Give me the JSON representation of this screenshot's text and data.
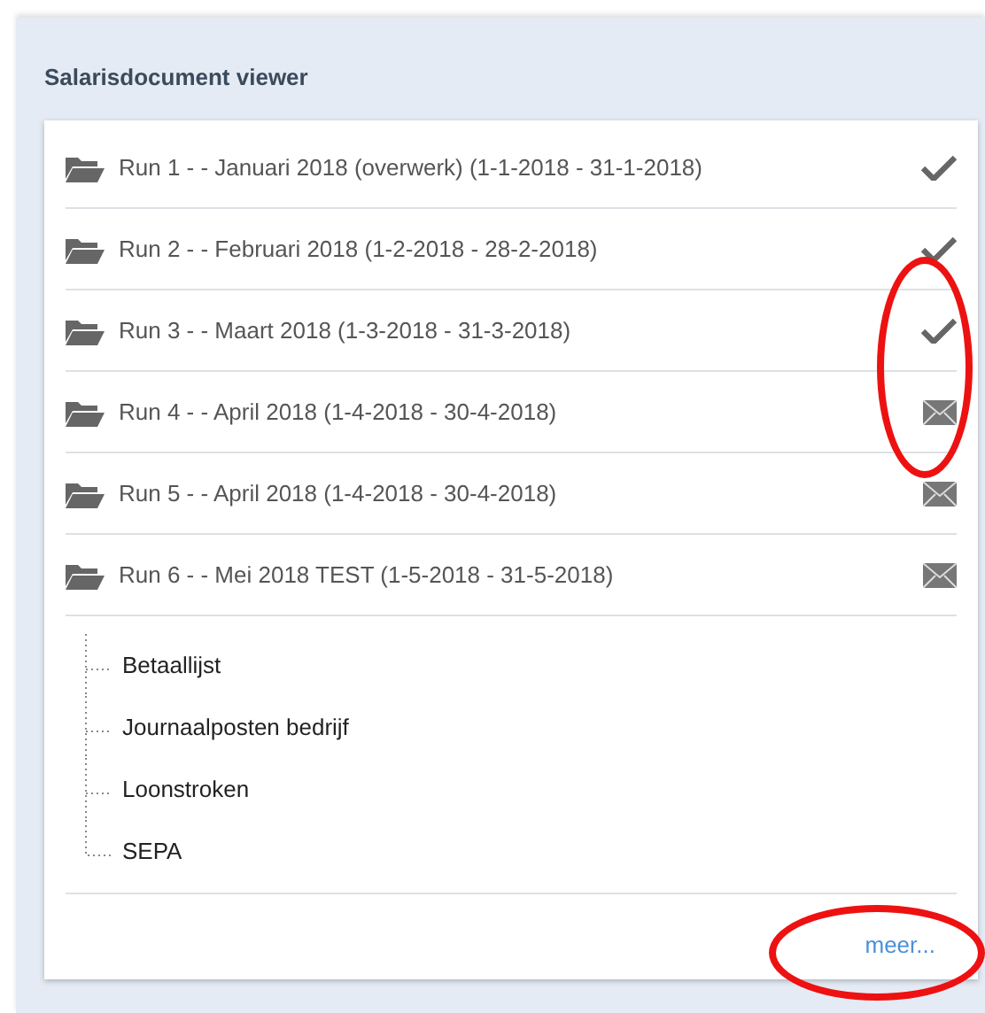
{
  "panel": {
    "title": "Salarisdocument viewer"
  },
  "runs": [
    {
      "label": "Run 1 - - Januari 2018 (overwerk) (1-1-2018 - 31-1-2018)",
      "kind": "done"
    },
    {
      "label": "Run 2 - - Februari 2018 (1-2-2018 - 28-2-2018)",
      "kind": "done"
    },
    {
      "label": "Run 3 - - Maart 2018 (1-3-2018 - 31-3-2018)",
      "kind": "done"
    },
    {
      "label": "Run 4 - - April 2018 (1-4-2018 - 30-4-2018)",
      "kind": "sent"
    },
    {
      "label": "Run 5 - - April 2018 (1-4-2018 - 30-4-2018)",
      "kind": "sent"
    },
    {
      "label": "Run 6 - - Mei 2018 TEST (1-5-2018 - 31-5-2018)",
      "kind": "sent",
      "children": [
        {
          "label": "Betaallijst"
        },
        {
          "label": "Journaalposten bedrijf"
        },
        {
          "label": "Loonstroken"
        },
        {
          "label": "SEPA"
        }
      ]
    }
  ],
  "more_link": "meer...",
  "annotations": [
    {
      "kind": "ellipse"
    },
    {
      "kind": "ellipse"
    }
  ]
}
